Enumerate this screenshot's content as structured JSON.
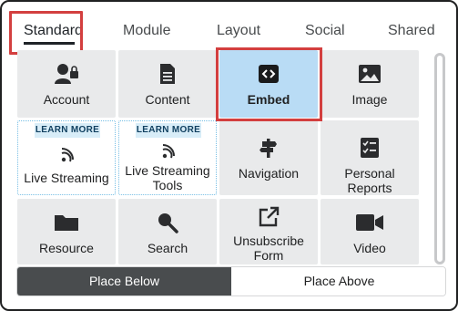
{
  "tabs": [
    {
      "label": "Standard",
      "active": true
    },
    {
      "label": "Module",
      "active": false
    },
    {
      "label": "Layout",
      "active": false
    },
    {
      "label": "Social",
      "active": false
    },
    {
      "label": "Shared",
      "active": false
    }
  ],
  "tiles": [
    {
      "label": "Account",
      "icon": "account-lock-icon"
    },
    {
      "label": "Content",
      "icon": "document-icon"
    },
    {
      "label": "Embed",
      "icon": "embed-code-icon",
      "selected": true
    },
    {
      "label": "Image",
      "icon": "image-icon"
    },
    {
      "label": "Live Streaming",
      "icon": "live-stream-icon",
      "badge": "LEARN MORE"
    },
    {
      "label": "Live Streaming Tools",
      "icon": "live-stream-icon",
      "badge": "LEARN MORE"
    },
    {
      "label": "Navigation",
      "icon": "signpost-icon"
    },
    {
      "label": "Personal Reports",
      "icon": "checklist-icon"
    },
    {
      "label": "Resource",
      "icon": "folder-icon"
    },
    {
      "label": "Search",
      "icon": "search-icon"
    },
    {
      "label": "Unsubscribe Form",
      "icon": "external-link-icon"
    },
    {
      "label": "Video",
      "icon": "video-camera-icon"
    }
  ],
  "placement": {
    "below_label": "Place Below",
    "above_label": "Place Above",
    "selected": "Place Below"
  },
  "colors": {
    "highlight": "#d33f3f",
    "selected_tile": "#b9dcf5",
    "tile": "#e9eaeb",
    "toggle_active": "#494c4e"
  }
}
